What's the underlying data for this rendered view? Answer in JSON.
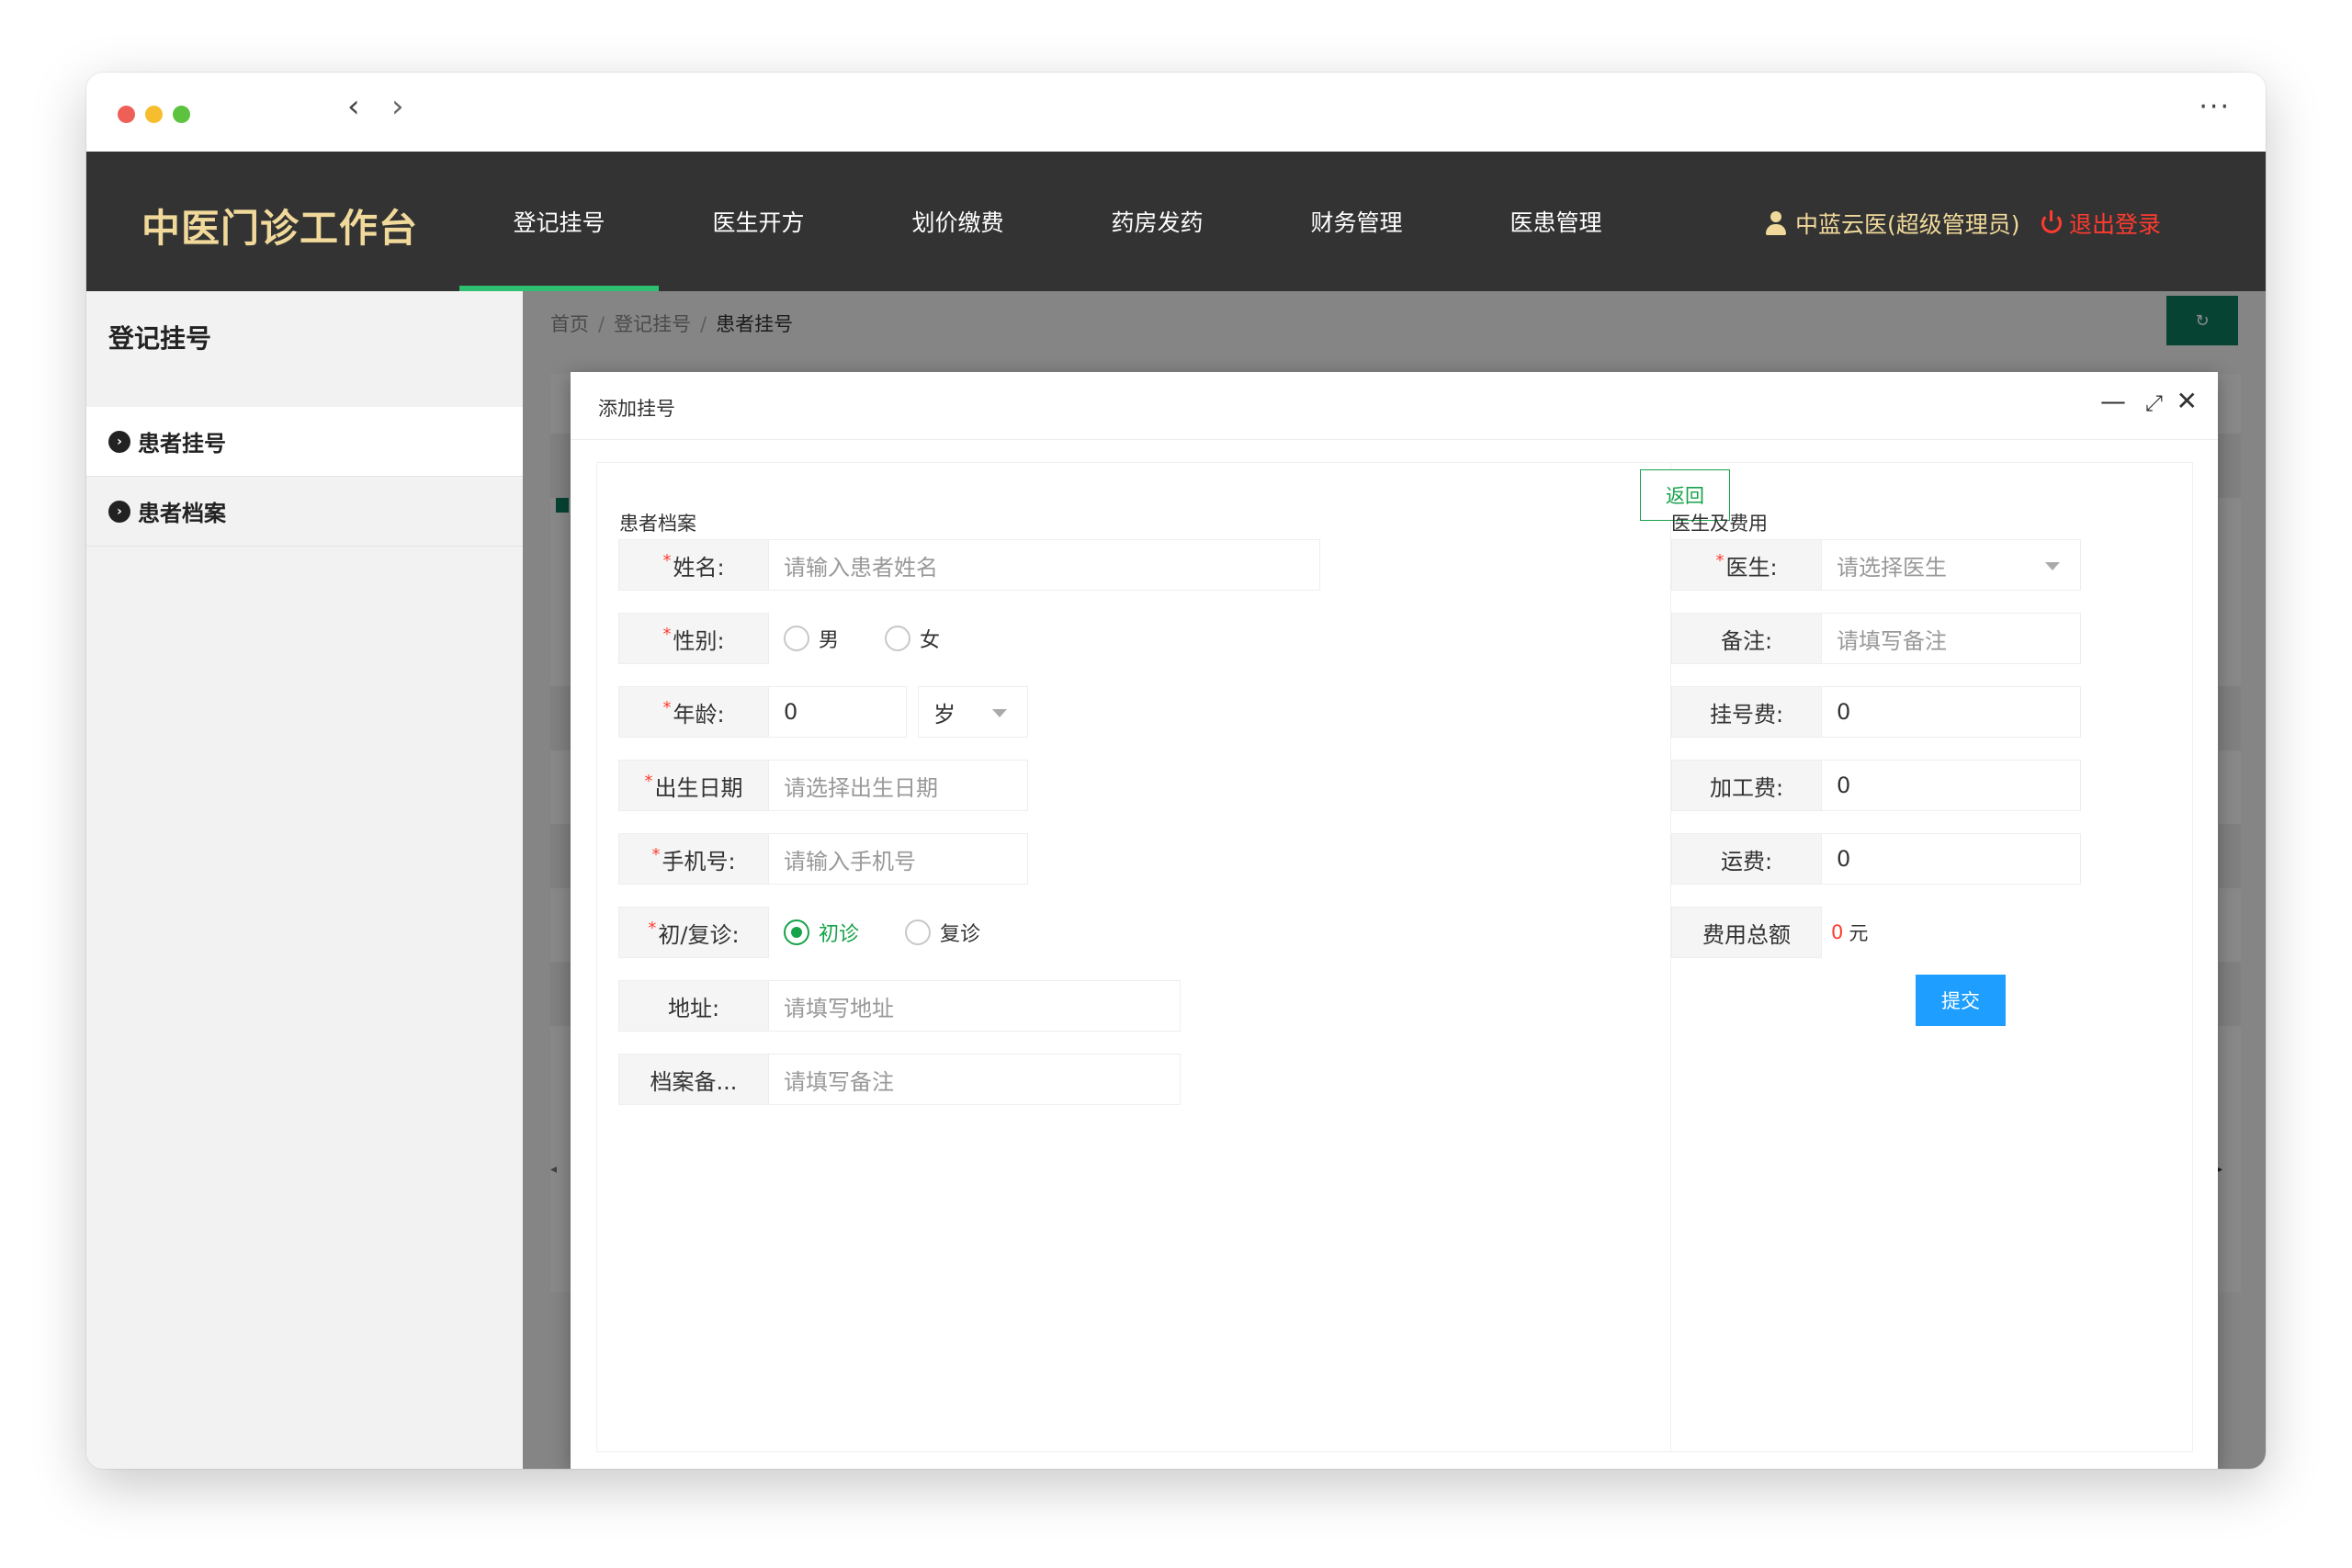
{
  "app": {
    "brand": "中医门诊工作台",
    "menu": [
      "登记挂号",
      "医生开方",
      "划价缴费",
      "药房发药",
      "财务管理",
      "医患管理"
    ],
    "active_menu": 0,
    "user": "中蓝云医(超级管理员)",
    "logout": "退出登录"
  },
  "sidebar": {
    "title": "登记挂号",
    "items": [
      "患者挂号",
      "患者档案"
    ]
  },
  "breadcrumb": {
    "home": "首页",
    "parent": "登记挂号",
    "current": "患者挂号"
  },
  "modal": {
    "title": "添加挂号",
    "left": {
      "title": "患者档案",
      "return_label": "返回",
      "name_label": "姓名:",
      "name_placeholder": "请输入患者姓名",
      "gender_label": "性别:",
      "gender_options": [
        "男",
        "女"
      ],
      "age_label": "年龄:",
      "age_value": "0",
      "age_unit": "岁",
      "birth_label": "出生日期",
      "birth_placeholder": "请选择出生日期",
      "phone_label": "手机号:",
      "phone_placeholder": "请输入手机号",
      "visit_label": "初/复诊:",
      "visit_options": [
        "初诊",
        "复诊"
      ],
      "visit_selected": "初诊",
      "address_label": "地址:",
      "address_placeholder": "请填写地址",
      "note_label": "档案备...",
      "note_placeholder": "请填写备注"
    },
    "right": {
      "title": "医生及费用",
      "doctor_label": "医生:",
      "doctor_placeholder": "请选择医生",
      "remark_label": "备注:",
      "remark_placeholder": "请填写备注",
      "reg_fee_label": "挂号费:",
      "reg_fee_value": "0",
      "process_fee_label": "加工费:",
      "process_fee_value": "0",
      "ship_fee_label": "运费:",
      "ship_fee_value": "0",
      "total_label": "费用总额",
      "total_value": "0",
      "total_unit": "元",
      "submit_label": "提交"
    }
  },
  "colors": {
    "header_bg": "#333333",
    "brand": "#f0d99a",
    "active_tab_underline": "#2fbf71",
    "primary_green": "#16a34a",
    "submit_blue": "#1e9fff",
    "danger": "#ff3b30"
  }
}
